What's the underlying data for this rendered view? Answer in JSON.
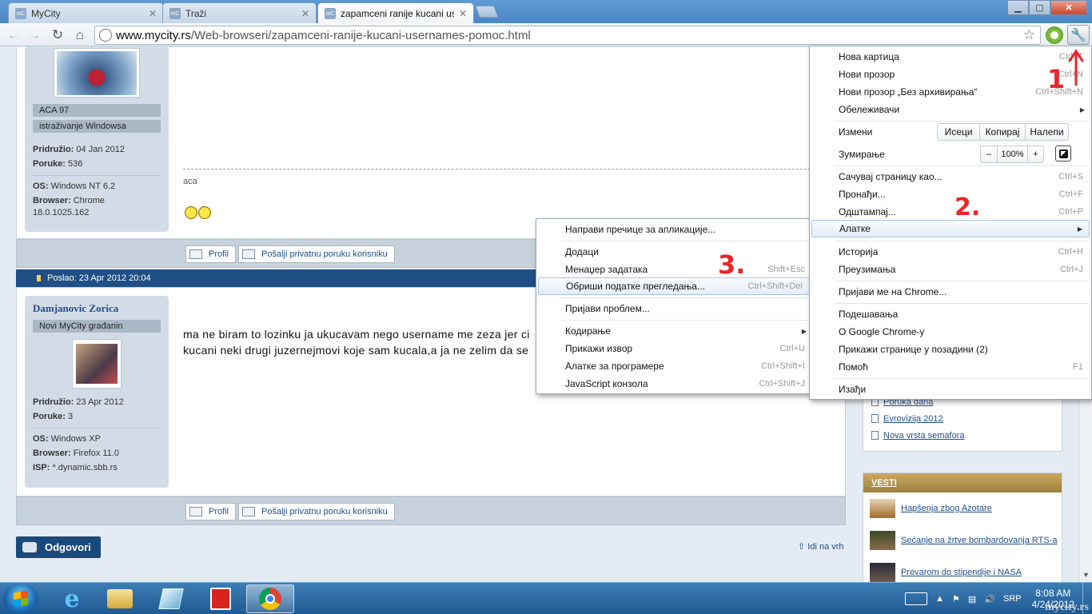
{
  "browser": {
    "tabs": [
      {
        "title": "MyCity",
        "favicon": "mC"
      },
      {
        "title": "Traži",
        "favicon": "mC"
      },
      {
        "title": "zapamceni ranije kucani use",
        "favicon": "mC"
      }
    ],
    "url_host": "www.mycity.rs",
    "url_path": "/Web-browseri/zapamceni-ranije-kucani-usernames-pomoc.html"
  },
  "post1": {
    "rank1": "ACA 97",
    "rank2": "istraživanje Windowsa",
    "joined_label": "Pridružio:",
    "joined": "04 Jan 2012",
    "posts_label": "Poruke:",
    "posts": "536",
    "os_label": "OS:",
    "os": "Windows NT 6.2",
    "browser_label": "Browser:",
    "browser": "Chrome 18.0.1025.162",
    "signature": "aca"
  },
  "actions": {
    "profile": "Profil",
    "pm": "Pošalji privatnu poruku korisniku"
  },
  "post2": {
    "posted": "Poslao: 23 Apr 2012 20:04",
    "username": "Damjanovic Zorica",
    "rank": "Novi MyCity građanin",
    "joined_label": "Pridružio:",
    "joined": "23 Apr 2012",
    "posts_label": "Poruke:",
    "posts": "3",
    "os_label": "OS:",
    "os": "Windows XP",
    "browser_label": "Browser:",
    "browser": "Firefox 11.0",
    "isp_label": "ISP:",
    "isp": "*.dynamic.sbb.rs",
    "text_line1": "ma ne biram to lozinku ja ukucavam nego username me zeza jer ci",
    "text_line2": "kucani neki drugi juzernejmovi koje sam kucala,a ja ne zelim da se"
  },
  "reply": "Odgovori",
  "to_top": "Idi na vrh",
  "sidebar": {
    "links": [
      "Poruka dana",
      "Evrovizija 2012",
      "Nova vrsta semafora"
    ],
    "vesti_title": "VESTI",
    "news": [
      "Hapšenja zbog Azotare",
      "Sećanje na žrtve bombardovanja RTS-a",
      "Prevarom do stipendije i NASA"
    ]
  },
  "chrome_menu": {
    "new_tab": "Нова картица",
    "new_tab_sc": "Ctrl+T",
    "new_window": "Нови прозор",
    "new_window_sc": "Ctrl+N",
    "incognito": "Нови прозор „Без архивирања“",
    "incognito_sc": "Ctrl+Shift+N",
    "bookmarks": "Обележивачи",
    "edit": "Измени",
    "cut": "Исеци",
    "copy": "Копирај",
    "paste": "Налепи",
    "zoom": "Зумирање",
    "zoom_minus": "–",
    "zoom_value": "100%",
    "zoom_plus": "+",
    "save_page": "Сачувај страницу као...",
    "save_page_sc": "Ctrl+S",
    "find": "Пронађи...",
    "find_sc": "Ctrl+F",
    "print": "Одштампај...",
    "print_sc": "Ctrl+P",
    "tools": "Алатке",
    "history": "Историја",
    "history_sc": "Ctrl+H",
    "downloads": "Преузимања",
    "downloads_sc": "Ctrl+J",
    "signin": "Пријави ме на Chrome...",
    "settings": "Подешавања",
    "about": "О Google Chrome-у",
    "background": "Прикажи странице у позадини (2)",
    "help": "Помоћ",
    "help_sc": "F1",
    "exit": "Изађи"
  },
  "tools_menu": {
    "shortcuts": "Направи пречице за апликације...",
    "extensions": "Додаци",
    "task_manager": "Менаџер задатака",
    "task_manager_sc": "Shift+Esc",
    "clear_data": "Обриши податке прегледања...",
    "clear_data_sc": "Ctrl+Shift+Del",
    "report": "Пријави проблем...",
    "encoding": "Кодирање",
    "view_source": "Прикажи извор",
    "view_source_sc": "Ctrl+U",
    "dev_tools": "Алатке за програмере",
    "dev_tools_sc": "Ctrl+Shift+I",
    "js_console": "JavaScript конзола",
    "js_console_sc": "Ctrl+Shift+J"
  },
  "annotations": {
    "one": "1",
    "two": "2.",
    "three": "3."
  },
  "taskbar": {
    "lang": "SRP",
    "time": "8:08 AM",
    "date": "4/24/2012",
    "watermark": "mycity.rs"
  },
  "colors": {
    "annotation": "#e8262b",
    "post_bar": "#1f4f84",
    "taskbar": "#1f5a93"
  }
}
